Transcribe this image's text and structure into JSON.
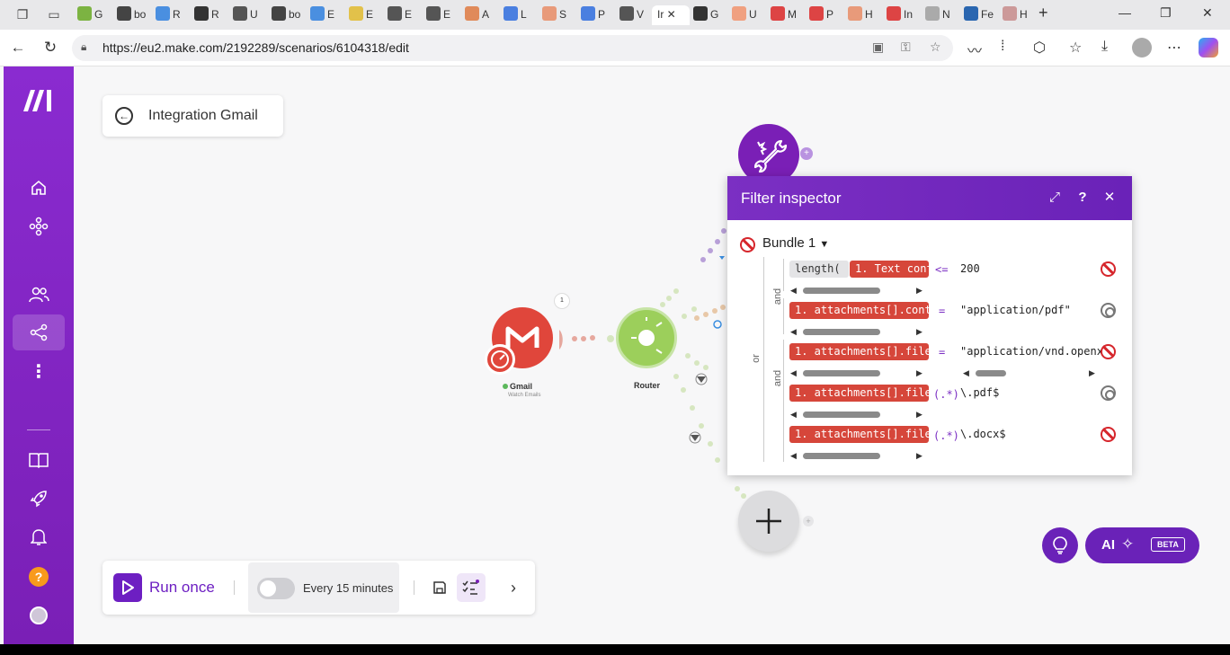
{
  "browser": {
    "url": "https://eu2.make.com/2192289/scenarios/6104318/edit",
    "active_tab_label": "Ir",
    "tabs": [
      {
        "label": "G",
        "color": "#7cb342"
      },
      {
        "label": "bo",
        "color": "#444"
      },
      {
        "label": "R",
        "color": "#4a8fe0"
      },
      {
        "label": "R",
        "color": "#333"
      },
      {
        "label": "U",
        "color": "#555"
      },
      {
        "label": "bo",
        "color": "#444"
      },
      {
        "label": "E",
        "color": "#4a8fe0"
      },
      {
        "label": "E",
        "color": "#e2c14a"
      },
      {
        "label": "E",
        "color": "#555"
      },
      {
        "label": "E",
        "color": "#555"
      },
      {
        "label": "A",
        "color": "#e08a5a"
      },
      {
        "label": "L",
        "color": "#4a7fe0"
      },
      {
        "label": "S",
        "color": "#e89a7a"
      },
      {
        "label": "P",
        "color": "#4a7fe0"
      },
      {
        "label": "V",
        "color": "#555"
      },
      {
        "label": "G",
        "color": "#333"
      },
      {
        "label": "U",
        "color": "#f0a080"
      },
      {
        "label": "M",
        "color": "#d44"
      },
      {
        "label": "P",
        "color": "#d44"
      },
      {
        "label": "H",
        "color": "#e89a7a"
      },
      {
        "label": "In",
        "color": "#d44"
      },
      {
        "label": "N",
        "color": "#aaa"
      },
      {
        "label": "Fe",
        "color": "#2a66b0"
      },
      {
        "label": "H",
        "color": "#c99"
      }
    ]
  },
  "sidebar": {
    "items": [
      {
        "name": "home",
        "icon": "⌂"
      },
      {
        "name": "templates",
        "icon": "✿"
      },
      {
        "name": "team",
        "icon": "☺"
      },
      {
        "name": "scenarios",
        "icon": "⋖"
      },
      {
        "name": "more",
        "icon": "⋮"
      },
      {
        "name": "docs",
        "icon": "▤"
      },
      {
        "name": "whats-new",
        "icon": "➶"
      },
      {
        "name": "notifications",
        "icon": "♫"
      }
    ],
    "help_label": "?"
  },
  "scenario": {
    "title": "Integration Gmail",
    "gmail_label": "Gmail",
    "gmail_sublabel": "Watch Emails",
    "gmail_badge": "1",
    "router_label": "Router"
  },
  "toolbar": {
    "run_label": "Run once",
    "schedule_label": "Every 15 minutes"
  },
  "inspector": {
    "title": "Filter inspector",
    "bundle_label": "Bundle 1",
    "group_or_label": "or",
    "group_and_label": "and",
    "conditions": [
      {
        "left_fn": "length(",
        "left": "1. Text cont",
        "op": "<=",
        "right": "200",
        "status": "fail"
      },
      {
        "left": "1. attachments[].cont",
        "op": "=",
        "right": "\"application/pdf\"",
        "status": "pass"
      },
      {
        "left": "1. attachments[].file",
        "op": "=",
        "right": "\"application/vnd.openx",
        "status": "fail"
      },
      {
        "left": "1. attachments[].file",
        "op": "(.*)",
        "right": "\\.pdf$",
        "status": "pass"
      },
      {
        "left": "1. attachments[].file",
        "op": "(.*)",
        "right": "\\.docx$",
        "status": "fail"
      }
    ]
  },
  "ai": {
    "ai_label": "AI",
    "beta_label": "BETA"
  }
}
